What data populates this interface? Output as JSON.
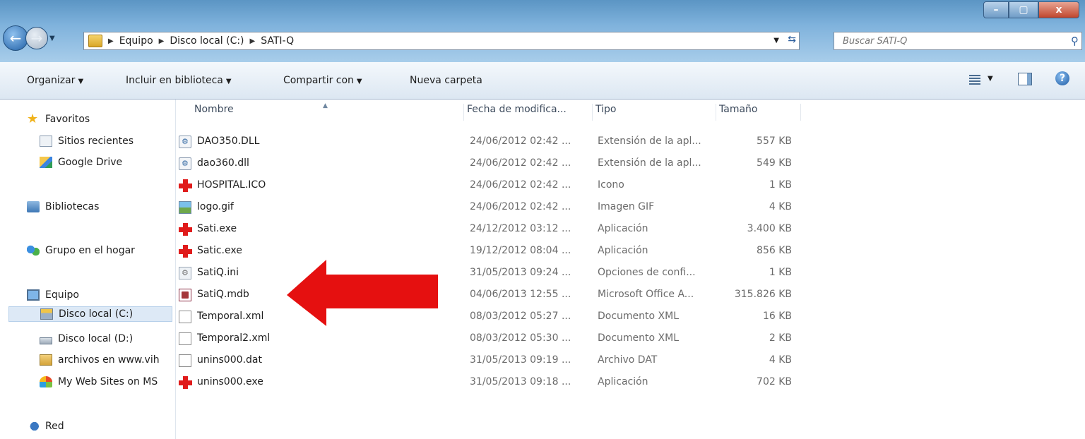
{
  "window": {
    "min_label": "–",
    "max_label": "▢",
    "close_label": "x"
  },
  "address": {
    "crumbs": [
      "Equipo",
      "Disco local (C:)",
      "SATI-Q"
    ],
    "separator": "▶",
    "dropdown": "▼",
    "refresh": "⇆"
  },
  "search": {
    "placeholder": "Buscar SATI-Q",
    "icon": "⚲"
  },
  "toolbar": {
    "organize": "Organizar",
    "include": "Incluir en biblioteca",
    "share": "Compartir con",
    "new_folder": "Nueva carpeta",
    "caret": "▼",
    "help": "?"
  },
  "nav": {
    "back": "←",
    "forward": "→",
    "dropdown": "▼",
    "favorites": "Favoritos",
    "recent": "Sitios recientes",
    "gdrive": "Google Drive",
    "libraries": "Bibliotecas",
    "homegroup": "Grupo en el hogar",
    "computer": "Equipo",
    "disk_c": "Disco local (C:)",
    "disk_d": "Disco local (D:)",
    "archives": "archivos en www.vih",
    "websites": "My Web Sites on MS",
    "network": "Red"
  },
  "columns": {
    "name": "Nombre",
    "date": "Fecha de modifica...",
    "type": "Tipo",
    "size": "Tamaño",
    "sort": "▲"
  },
  "files": [
    {
      "name": "DAO350.DLL",
      "date": "24/06/2012 02:42 ...",
      "type": "Extensión de la apl...",
      "size": "557 KB",
      "icon": "dll-icon"
    },
    {
      "name": "dao360.dll",
      "date": "24/06/2012 02:42 ...",
      "type": "Extensión de la apl...",
      "size": "549 KB",
      "icon": "dll-icon"
    },
    {
      "name": "HOSPITAL.ICO",
      "date": "24/06/2012 02:42 ...",
      "type": "Icono",
      "size": "1 KB",
      "icon": "red-cross-icon"
    },
    {
      "name": "logo.gif",
      "date": "24/06/2012 02:42 ...",
      "type": "Imagen GIF",
      "size": "4 KB",
      "icon": "gif-image-icon"
    },
    {
      "name": "Sati.exe",
      "date": "24/12/2012 03:12 ...",
      "type": "Aplicación",
      "size": "3.400 KB",
      "icon": "red-cross-icon"
    },
    {
      "name": "Satic.exe",
      "date": "19/12/2012 08:04 ...",
      "type": "Aplicación",
      "size": "856 KB",
      "icon": "red-cross-icon"
    },
    {
      "name": "SatiQ.ini",
      "date": "31/05/2013 09:24 ...",
      "type": "Opciones de confi...",
      "size": "1 KB",
      "icon": "ini-settings-icon"
    },
    {
      "name": "SatiQ.mdb",
      "date": "04/06/2013 12:55 ...",
      "type": "Microsoft Office A...",
      "size": "315.826 KB",
      "icon": "access-database-icon"
    },
    {
      "name": "Temporal.xml",
      "date": "08/03/2012 05:27 ...",
      "type": "Documento XML",
      "size": "16 KB",
      "icon": "blank-document-icon"
    },
    {
      "name": "Temporal2.xml",
      "date": "08/03/2012 05:30 ...",
      "type": "Documento XML",
      "size": "2 KB",
      "icon": "blank-document-icon"
    },
    {
      "name": "unins000.dat",
      "date": "31/05/2013 09:19 ...",
      "type": "Archivo DAT",
      "size": "4 KB",
      "icon": "blank-document-icon"
    },
    {
      "name": "unins000.exe",
      "date": "31/05/2013 09:18 ...",
      "type": "Aplicación",
      "size": "702 KB",
      "icon": "red-cross-icon"
    }
  ],
  "colors": {
    "annotation_arrow": "#e51010",
    "selected_nav": "#dde9f6"
  }
}
